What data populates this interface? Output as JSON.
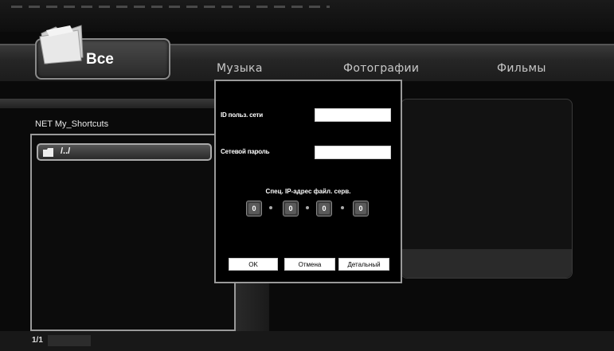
{
  "tabs": [
    {
      "label": "Все"
    },
    {
      "label": "Музыка"
    },
    {
      "label": "Фотографии"
    },
    {
      "label": "Фильмы"
    }
  ],
  "browser": {
    "location": "NET My_Shortcuts",
    "items": [
      {
        "label": "/../"
      }
    ],
    "page_indicator": "1/1"
  },
  "dialog": {
    "user_id_label": "ID польз. сети",
    "user_id_value": "",
    "password_label": "Сетевой пароль",
    "password_value": "",
    "ip_title": "Спец. IP-адрес файл. серв.",
    "ip_octets": [
      "0",
      "0",
      "0",
      "0"
    ],
    "buttons": {
      "ok": "OK",
      "cancel": "Отмена",
      "details": "Детальный"
    }
  }
}
